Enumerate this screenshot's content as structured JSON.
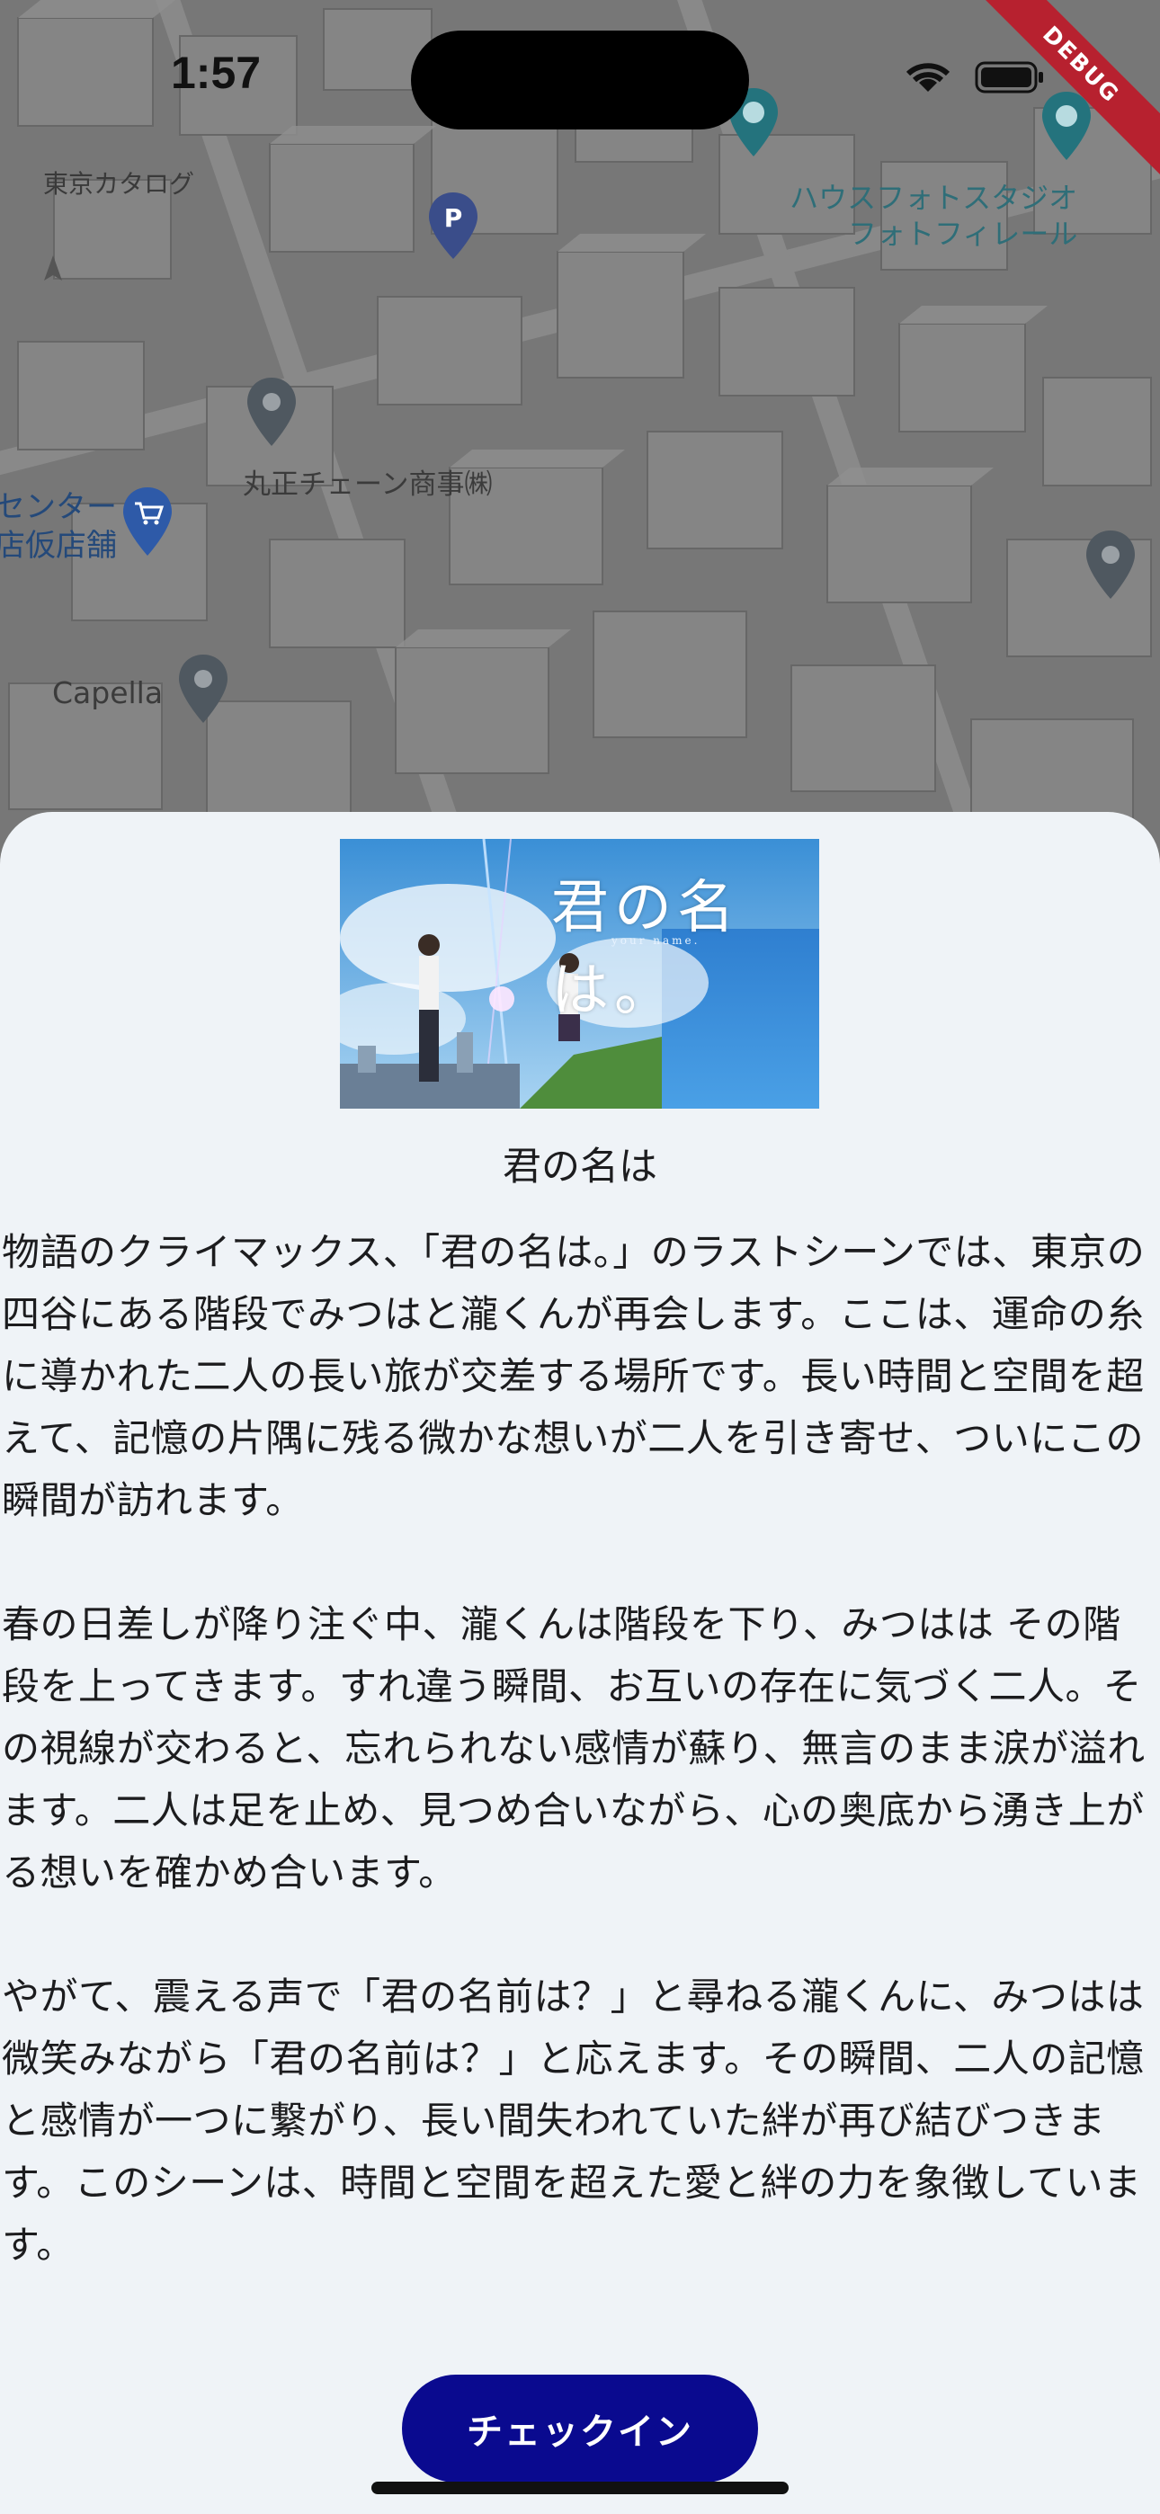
{
  "status_bar": {
    "time": "1:57",
    "icons": [
      "signal-icon",
      "wifi-icon",
      "battery-icon"
    ]
  },
  "debug_banner": "DEBUG",
  "map": {
    "labels": {
      "tokyo_catalog": "東京カタログ",
      "house_photo_line1": "ハウスフォトスタジオ",
      "house_photo_line2": "フォトフィレール",
      "marumasa": "丸正チェーン商事㈱",
      "center_line1": "センター",
      "center_line2": "店仮店舗",
      "capella": "Capella"
    },
    "pins": [
      "parking-pin-icon",
      "place-pin-icon",
      "shopping-pin-icon",
      "camera-pin-icon"
    ]
  },
  "sheet": {
    "poster_title": "君の名は。",
    "poster_subtitle": "your name.",
    "title": "君の名は",
    "paragraphs": [
      "物語のクライマックス、「君の名は。」のラストシーンでは、東京の四谷にある階段でみつはと瀧くんが再会します。ここは、運命の糸に導かれた二人の長い旅が交差する場所です。長い時間と空間を超えて、記憶の片隅に残る微かな想いが二人を引き寄せ、ついにこの瞬間が訪れます。",
      "春の日差しが降り注ぐ中、瀧くんは階段を下り、みつはは その階段を上ってきます。すれ違う瞬間、お互いの存在に気づく二人。その視線が交わると、忘れられない感情が蘇り、無言のまま涙が溢れます。二人は足を止め、見つめ合いながら、心の奥底から湧き上がる想いを確かめ合います。",
      "やがて、震える声で「君の名前は？」と尋ねる瀧くんに、みつはは微笑みながら「君の名前は？」と応えます。その瞬間、二人の記憶と感情が一つに繋がり、長い間失われていた絆が再び結びつきます。このシーンは、時間と空間を超えた愛と絆の力を象徴しています。"
    ],
    "checkin_label": "チェックイン"
  },
  "colors": {
    "sheet_background": "#eff3f7",
    "button": "#0a0a8f",
    "debug_ribbon": "#b7212f"
  }
}
